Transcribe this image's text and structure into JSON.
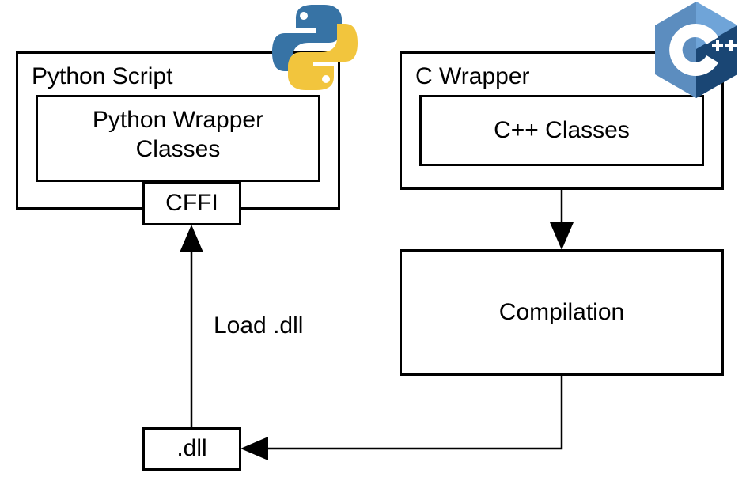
{
  "left": {
    "outer_title": "Python Script",
    "inner_title_line1": "Python Wrapper",
    "inner_title_line2": "Classes",
    "cffi_label": "CFFI"
  },
  "right": {
    "outer_title": "C Wrapper",
    "inner_title": "C++ Classes",
    "compilation_label": "Compilation"
  },
  "bottom": {
    "dll_label": ".dll",
    "load_label": "Load .dll"
  },
  "icons": {
    "python": "python-logo-icon",
    "cpp": "cpp-logo-icon"
  },
  "colors": {
    "python_blue": "#3773A5",
    "python_yellow": "#F2C53D",
    "cpp_mid": "#5C8DBF",
    "cpp_dark": "#1A4674",
    "cpp_light": "#6FA4D8"
  }
}
